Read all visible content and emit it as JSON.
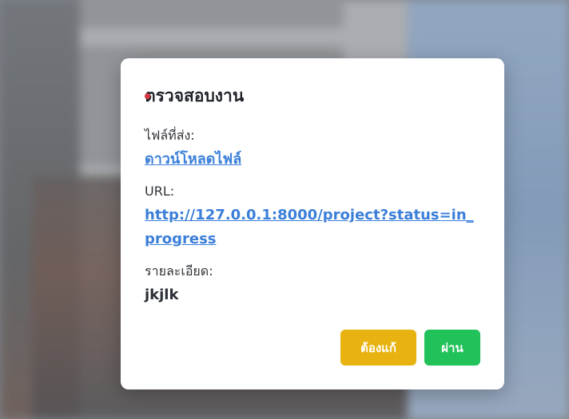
{
  "modal": {
    "title": "ตรวจสอบงาน",
    "file_label": "ไฟล์ที่ส่ง:",
    "file_link": "ดาวน์โหลดไฟล์",
    "url_label": "URL:",
    "url_link": "http://127.0.0.1:8000/project?status=in_progress",
    "detail_label": "รายละเอียด:",
    "detail_value": "jkjlk",
    "revise_button": "ต้องแก้",
    "pass_button": "ผ่าน"
  },
  "colors": {
    "link": "#3b7fd9",
    "revise": "#e8b310",
    "pass": "#22c25a"
  }
}
